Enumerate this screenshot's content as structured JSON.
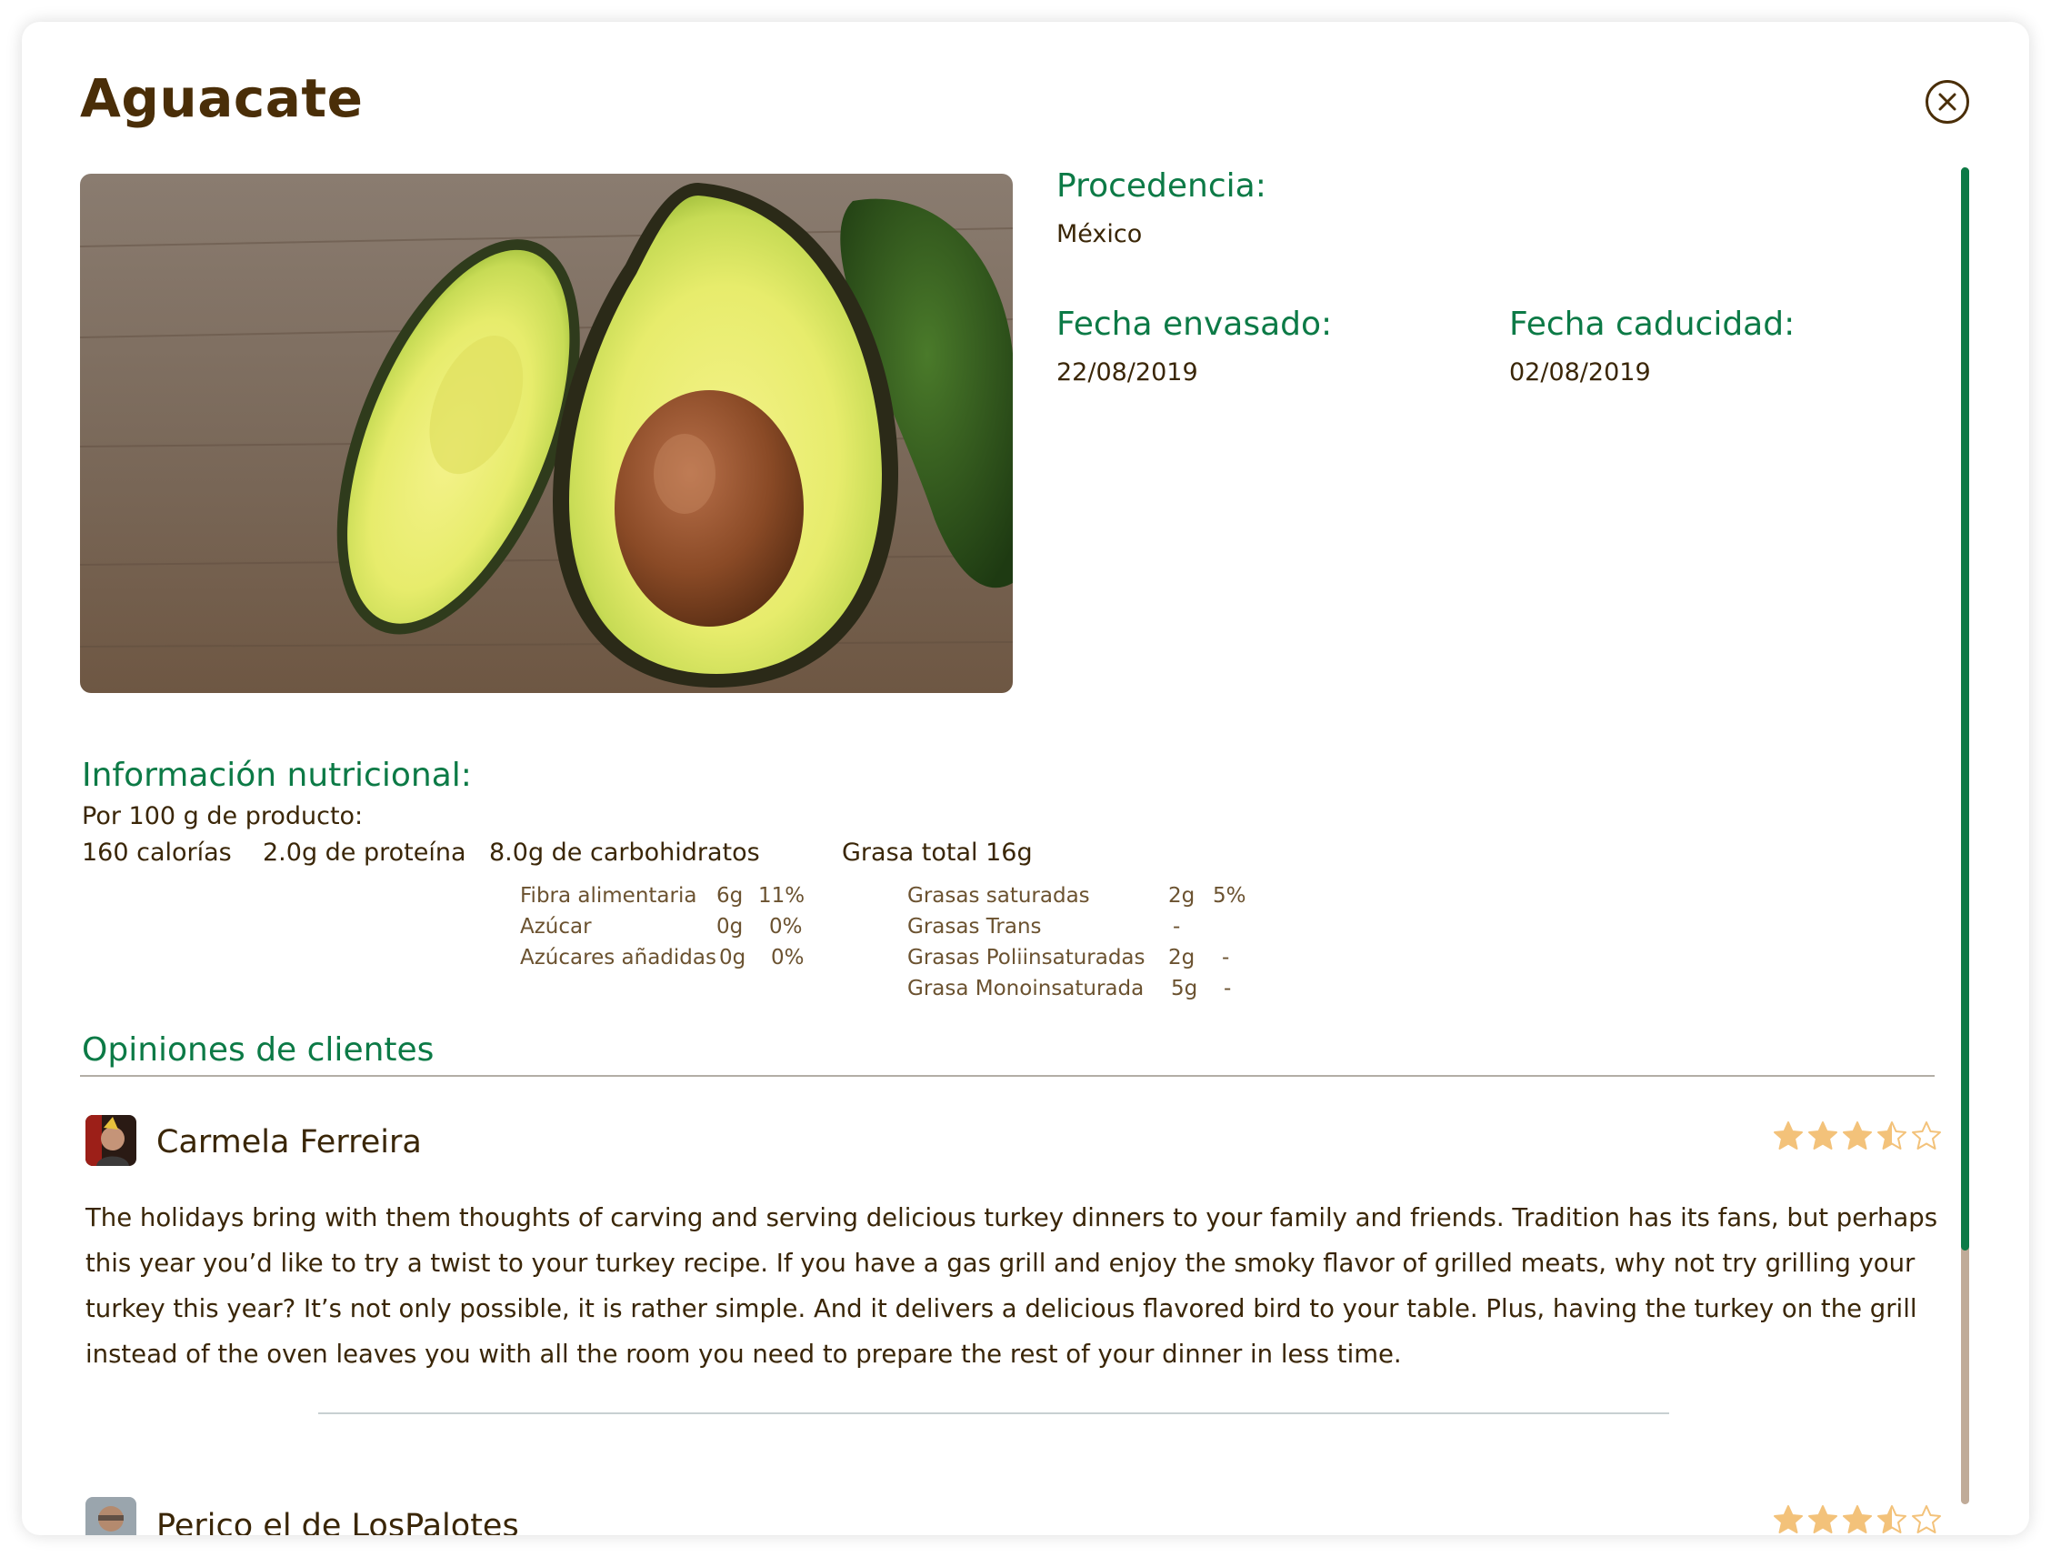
{
  "product": {
    "title": "Aguacate",
    "image_icon": "avocado-image"
  },
  "details": {
    "origin_label": "Procedencia:",
    "origin_value": "México",
    "packed_label": "Fecha envasado:",
    "packed_value": "22/08/2019",
    "expiry_label": "Fecha caducidad:",
    "expiry_value": "02/08/2019"
  },
  "nutrition": {
    "heading": "Información nutricional:",
    "per": "Por 100 g de producto:",
    "calories": "160 calorías",
    "protein": "2.0g de proteína",
    "carbs": "8.0g de carbohidratos",
    "fat": "Grasa total 16g",
    "carb_rows": [
      {
        "name": "Fibra alimentaria",
        "amount": "6g",
        "pct": "11%"
      },
      {
        "name": "Azúcar",
        "amount": "0g",
        "pct": "0%"
      },
      {
        "name": "Azúcares añadidas",
        "amount": "0g",
        "pct": "0%"
      }
    ],
    "fat_rows": [
      {
        "name": "Grasas saturadas",
        "amount": "2g",
        "pct": "5%"
      },
      {
        "name": "Grasas Trans",
        "amount": "-",
        "pct": ""
      },
      {
        "name": "Grasas Poliinsaturadas",
        "amount": "2g",
        "pct": "-"
      },
      {
        "name": "Grasa Monoinsaturada",
        "amount": "5g",
        "pct": "-"
      }
    ]
  },
  "reviews": {
    "heading": "Opiniones de clientes",
    "items": [
      {
        "name": "Carmela Ferreira",
        "rating": 3.5,
        "text": "The holidays bring with them thoughts of carving and serving delicious turkey dinners to your family and friends. Tradition has its fans, but perhaps this year you’d like to try a twist to your turkey recipe. If you have a gas grill and enjoy the smoky flavor of grilled meats, why not try grilling your turkey this year? It’s not only possible, it is rather simple. And it delivers a delicious flavored bird to your table. Plus, having the turkey on the grill instead of the oven leaves you with all the room you need to prepare the rest of your dinner in less time."
      },
      {
        "name": "Perico el de LosPalotes",
        "rating": 3.5
      }
    ]
  },
  "colors": {
    "accent": "#0c7a46",
    "title": "#4a2e08",
    "star": "#f3c27a"
  },
  "scroll_position": 0.81
}
